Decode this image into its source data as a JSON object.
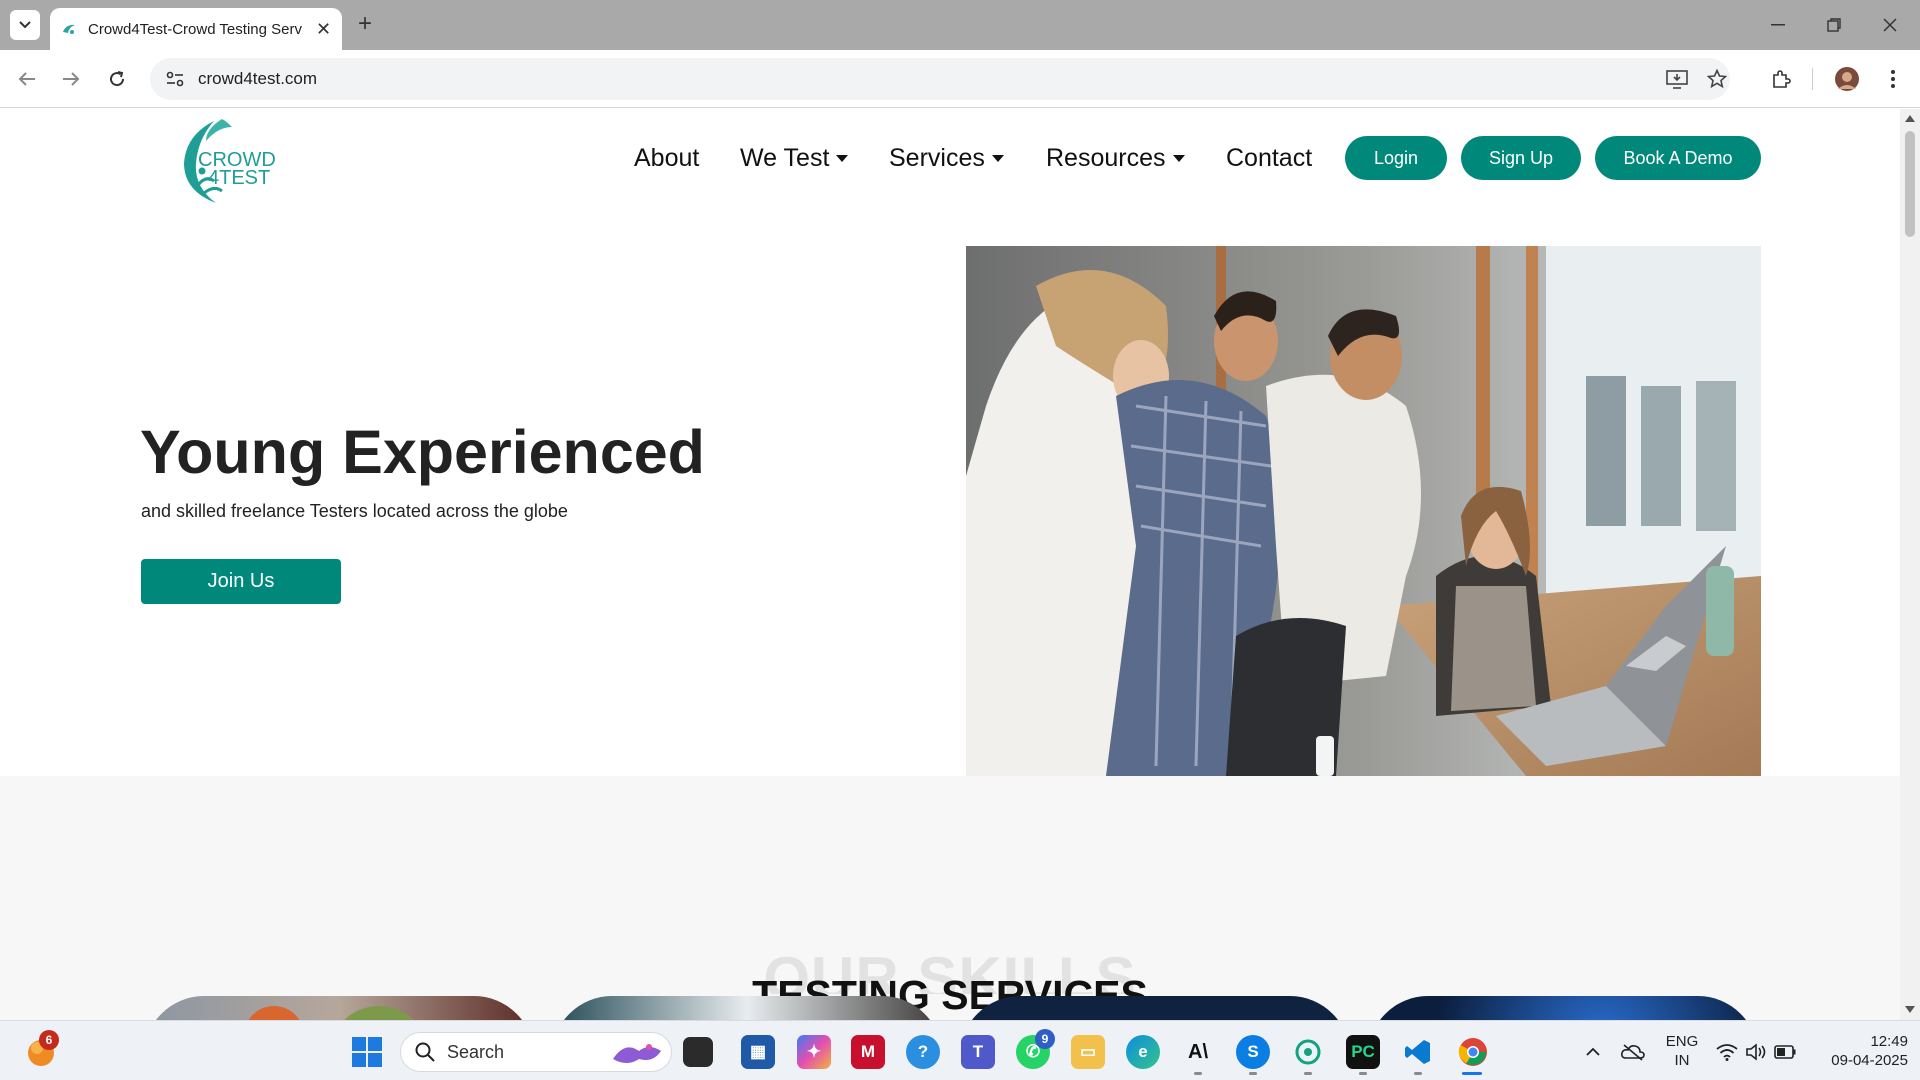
{
  "browser": {
    "tab_title": "Crowd4Test-Crowd Testing Serv",
    "url": "crowd4test.com"
  },
  "site": {
    "logo_line1": "CROWD",
    "logo_line2": "4TEST",
    "nav": {
      "about": "About",
      "we_test": "We Test",
      "services": "Services",
      "resources": "Resources",
      "contact": "Contact"
    },
    "buttons": {
      "login": "Login",
      "signup": "Sign Up",
      "demo": "Book A Demo"
    },
    "hero": {
      "title": "Young Experienced",
      "subtitle": "and skilled freelance Testers located across the globe",
      "cta": "Join Us"
    },
    "skills": {
      "background_text": "OUR SKILLS",
      "title": "TESTING SERVICES"
    },
    "colors": {
      "brand": "#00897b"
    }
  },
  "taskbar": {
    "search_label": "Search",
    "notification_count": "6",
    "whatsapp_badge": "9",
    "lang_line1": "ENG",
    "lang_line2": "IN",
    "time": "12:49",
    "date": "09-04-2025"
  }
}
